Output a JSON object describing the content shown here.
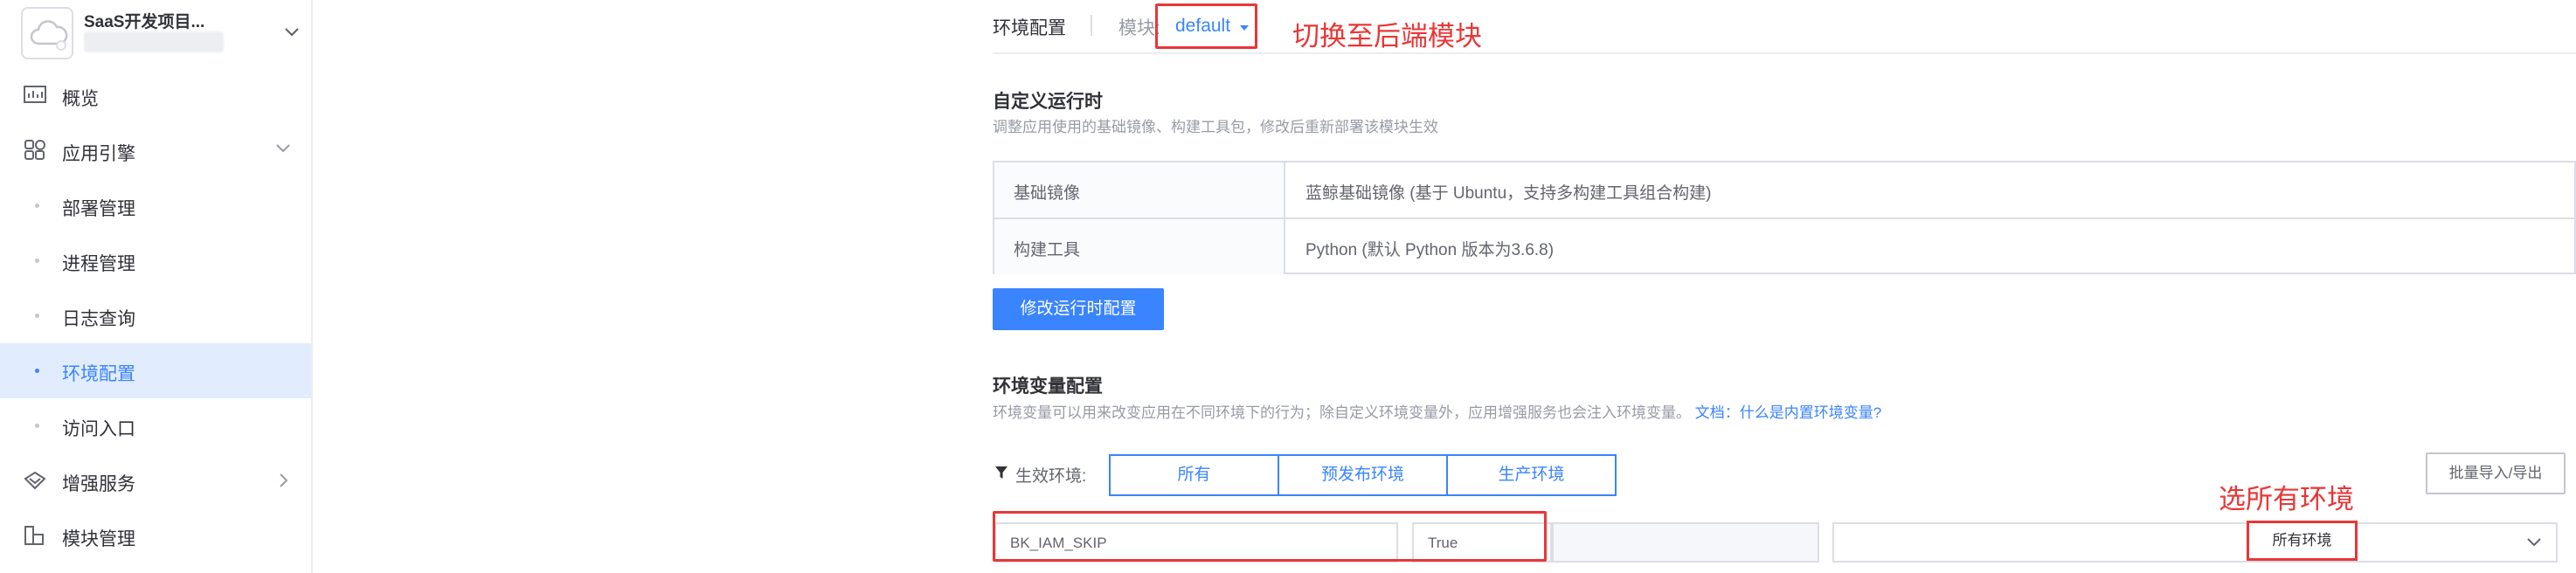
{
  "sidebar": {
    "project_name": "SaaS开发项目...",
    "items": [
      {
        "label": "概览",
        "icon": "overview-chart-icon"
      },
      {
        "label": "应用引擎",
        "icon": "app-engine-icon"
      },
      {
        "label": "部署管理"
      },
      {
        "label": "进程管理"
      },
      {
        "label": "日志查询"
      },
      {
        "label": "环境配置"
      },
      {
        "label": "访问入口"
      },
      {
        "label": "增强服务",
        "icon": "enhanced-service-icon"
      },
      {
        "label": "模块管理",
        "icon": "module-manage-icon"
      }
    ]
  },
  "header": {
    "title": "环境配置",
    "module_label": "模块:",
    "module_value": "default"
  },
  "annotations": {
    "switch_backend": "切换至后端模块",
    "select_all_env": "选所有环境"
  },
  "runtime": {
    "title": "自定义运行时",
    "desc": "调整应用使用的基础镜像、构建工具包，修改后重新部署该模块生效",
    "rows": [
      {
        "key": "基础镜像",
        "value": "蓝鲸基础镜像 (基于 Ubuntu，支持多构建工具组合构建)"
      },
      {
        "key": "构建工具",
        "value": "Python (默认 Python 版本为3.6.8)"
      }
    ],
    "modify_button": "修改运行时配置"
  },
  "env_vars": {
    "title": "环境变量配置",
    "desc": "环境变量可以用来改变应用在不同环境下的行为；除自定义环境变量外，应用增强服务也会注入环境变量。",
    "doc_link": "文档：什么是内置环境变量?",
    "filter_label": "生效环境:",
    "segments": [
      "所有",
      "预发布环境",
      "生产环境"
    ],
    "batch_button": "批量导入/导出",
    "row": {
      "key": "BK_IAM_SKIP",
      "value": "True",
      "description": "",
      "env": "所有环境"
    }
  },
  "colors": {
    "primary": "#3a84ff",
    "annotation_red": "#ea3636"
  }
}
